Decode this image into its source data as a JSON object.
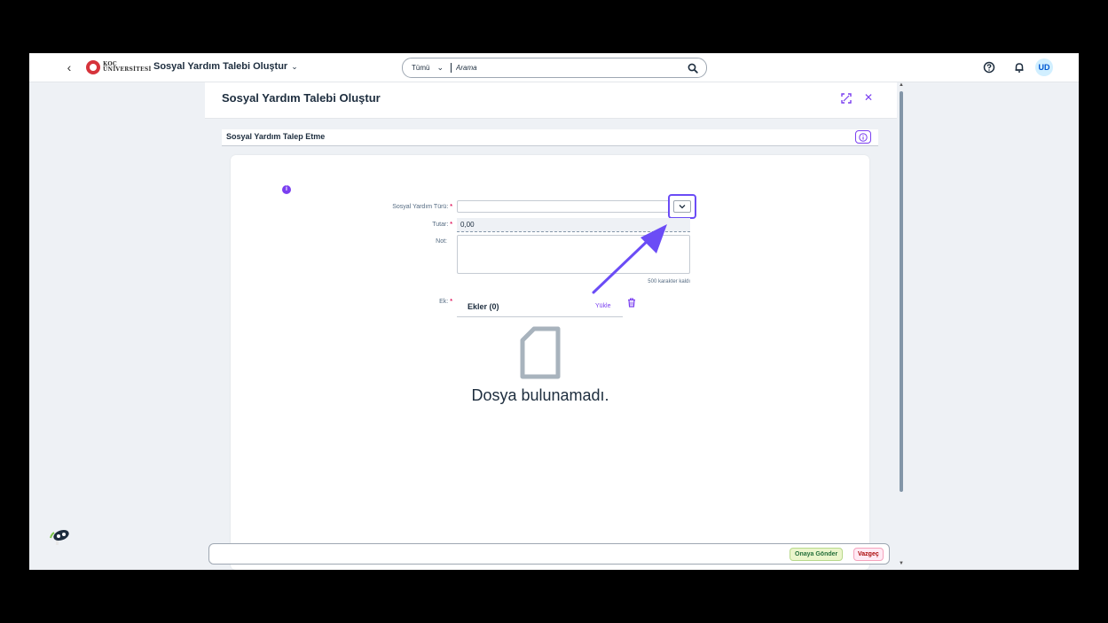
{
  "shell": {
    "logo_line1": "KOÇ",
    "logo_line2": "ÜNİVERSİTESİ",
    "app_title": "Sosyal Yardım Talebi Oluştur",
    "search_scope": "Tümü",
    "search_placeholder": "Arama",
    "avatar_initials": "UD"
  },
  "dialog": {
    "title": "Sosyal Yardım Talebi Oluştur",
    "section_title": "Sosyal Yardım Talep Etme",
    "form": {
      "type_label": "Sosyal Yardım Türü:",
      "type_value": "",
      "amount_label": "Tutar:",
      "amount_value": "0,00",
      "note_label": "Not:",
      "note_value": "",
      "char_count": "500 karakter kaldı",
      "required_marker": "*"
    },
    "attachments": {
      "label": "Ek:",
      "title": "Ekler (0)",
      "upload": "Yükle",
      "empty_text": "Dosya bulunamadı."
    },
    "footer": {
      "approve": "Onaya Gönder",
      "cancel": "Vazgeç"
    }
  },
  "colors": {
    "accent": "#7a3ff0",
    "highlight": "#6b4cf6",
    "approve_bg": "#ebf5cb",
    "cancel_bg": "#ffeaf4"
  },
  "icons": [
    "back-icon",
    "search-icon",
    "help-icon",
    "bell-icon",
    "expand-icon",
    "close-icon",
    "info-icon",
    "chevron-down-icon",
    "trash-icon",
    "file-icon",
    "feedback-icon"
  ]
}
